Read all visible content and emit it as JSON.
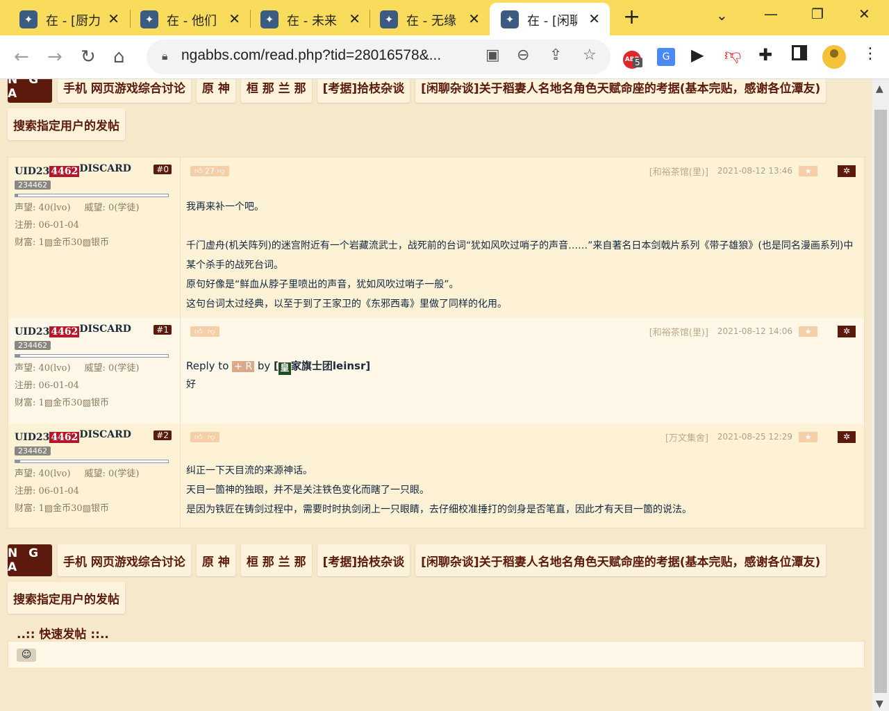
{
  "browser": {
    "tabs": [
      {
        "favicon": "nga-favicon",
        "title": "在 - [厨力",
        "close": "✕"
      },
      {
        "favicon": "nga-favicon",
        "title": "在 - 他们",
        "close": "✕"
      },
      {
        "favicon": "nga-favicon",
        "title": "在 - 未来",
        "close": "✕"
      },
      {
        "favicon": "nga-favicon",
        "title": "在 - 无缘",
        "close": "✕"
      },
      {
        "favicon": "nga-favicon",
        "title": "在 - [闲聊",
        "close": "✕"
      }
    ],
    "url": "ngabbs.com/read.php?tid=28016578&...",
    "extension_badge": "5",
    "colors": {
      "tabbar": "#f9dc5c",
      "accent": "#5b1a0c"
    }
  },
  "nav": {
    "logo": "N G A",
    "items": [
      "手机 网页游戏综合讨论",
      "原 神",
      "桓 那 兰 那",
      "[考据]拾枝杂谈",
      "[闲聊杂谈]关于稻妻人名地名角色天赋命座的考据(基本完贴，感谢各位潭友)"
    ],
    "search_user_posts": "搜索指定用户的发帖"
  },
  "posts": [
    {
      "user_prefix": "UID23",
      "user_highlight": "4462",
      "user_suffix": "DISCARD",
      "floor": "#0",
      "uid_badge": "234462",
      "prestige": "声望: 40(lvo)",
      "authority": "威望: 0(学徒)",
      "register": "注册: 06-01-04",
      "wealth": "财富: 1",
      "gold": "金币",
      "silver_num": "30",
      "silver": "银币",
      "likes": "27",
      "level_bar": 0.02,
      "location": "[和裕茶馆(里)]",
      "time": "2021-08-12 13:46",
      "lines": [
        "我再来补一个吧。",
        "",
        "千门虚舟(机关阵列)的迷宫附近有一个岩藏流武士，战死前的台词“犹如风吹过哨子的声音……”来自著名日本剑戟片系列《带子雄狼》(也是同名漫画系列)中某个杀手的战死台词。",
        "原句好像是“鲜血从脖子里喷出的声音，犹如风吹过哨子一般”。",
        "这句台词太过经典，以至于到了王家卫的《东邪西毒》里做了同样的化用。"
      ]
    },
    {
      "user_prefix": "UID23",
      "user_highlight": "4462",
      "user_suffix": "DISCARD",
      "floor": "#1",
      "uid_badge": "234462",
      "prestige": "声望: 40(lvo)",
      "authority": "威望: 0(学徒)",
      "register": "注册: 06-01-04",
      "wealth": "财富: 1",
      "gold": "金币",
      "silver_num": "30",
      "silver": "银币",
      "level_bar": 0.03,
      "location": "[和裕茶馆(里)]",
      "time": "2021-08-12 14:06",
      "reply_prefix": "Reply to",
      "reply_tag": "+ R",
      "reply_by": "by",
      "reply_open": "[",
      "reply_flag": "皇",
      "reply_user": "家旗士团leinsr",
      "reply_close": "]",
      "lines": [
        "好"
      ]
    },
    {
      "user_prefix": "UID23",
      "user_highlight": "4462",
      "user_suffix": "DISCARD",
      "floor": "#2",
      "uid_badge": "234462",
      "prestige": "声望: 40(lvo)",
      "authority": "威望: 0(学徒)",
      "register": "注册: 06-01-04",
      "wealth": "财富: 1",
      "gold": "金币",
      "silver_num": "30",
      "silver": "银币",
      "level_bar": 0.03,
      "location": "[万文集舍]",
      "time": "2021-08-25 12:29",
      "lines": [
        "纠正一下天目流的来源神话。",
        "天目一箇神的独眼，并不是关注铁色变化而瞎了一只眼。",
        "是因为铁匠在铸剑过程中，需要时时执剑闭上一只眼睛，去仔细校准捶打的剑身是否笔直，因此才有天目一箇的说法。"
      ]
    }
  ],
  "quick_post": {
    "title": "..:: 快速发帖 ::..",
    "emoji": "☺"
  }
}
